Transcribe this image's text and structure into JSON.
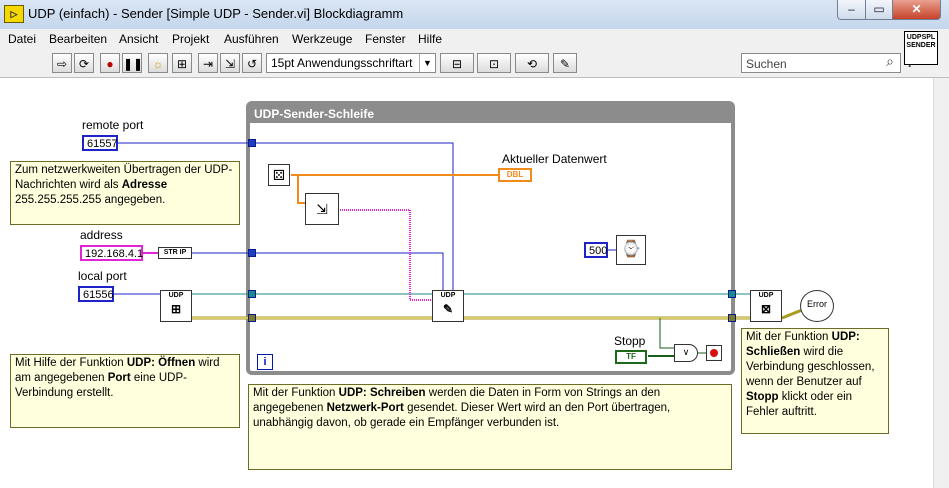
{
  "window": {
    "app_icon_label": "▷",
    "title": "UDP (einfach) - Sender [Simple UDP - Sender.vi] Blockdiagramm",
    "controls": {
      "minimize": "–",
      "maximize": "▭",
      "close": "✕"
    }
  },
  "menu": [
    "Datei",
    "Bearbeiten",
    "Ansicht",
    "Projekt",
    "Ausführen",
    "Werkzeuge",
    "Fenster",
    "Hilfe"
  ],
  "toolbar": {
    "buttons": [
      "⇨",
      "⟳",
      "●",
      "❚❚",
      "☼",
      "⊞",
      "⇥",
      "⇲",
      "↺"
    ],
    "font_value": "15pt Anwendungsschriftart",
    "align_icon": "⊟",
    "distribute_icon": "⊡",
    "reorder_icon": "⟲",
    "cleanup_icon": "✎",
    "search_placeholder": "Suchen",
    "help_glyph": "?",
    "vi_icon_lines": [
      "UDPSPL",
      "SENDER"
    ]
  },
  "diagram": {
    "loop_title": "UDP-Sender-Schleife",
    "loop_index": "i",
    "labels": {
      "remote_port": "remote port",
      "address": "address",
      "local_port": "local port",
      "current_value": "Aktueller Datenwert",
      "stop": "Stopp"
    },
    "constants": {
      "remote_port": "61557",
      "address": "192.168.4.1",
      "local_port": "61556",
      "wait_ms": "500",
      "str_ip": "STR IP",
      "dbl": "DBL",
      "tf": "TF"
    },
    "nodes": {
      "udp_open": "UDP",
      "udp_write": "UDP",
      "udp_close": "UDP",
      "error": "Error"
    },
    "comments": {
      "address": [
        {
          "text": "Zum netzwerkweiten Übertragen der UDP-"
        },
        {
          "text": "Nachrichten wird als "
        },
        {
          "bold": "Adresse"
        },
        {
          "text": "255.255.255.255 angegeben."
        }
      ],
      "open": [
        {
          "text": "Mit Hilfe der Funktion "
        },
        {
          "bold": "UDP: Öffnen"
        },
        {
          "text": " wird"
        },
        {
          "text": "am angegebenen "
        },
        {
          "bold": "Port"
        },
        {
          "text": " eine UDP-"
        },
        {
          "text": "Verbindung erstellt."
        }
      ],
      "write": [
        {
          "text": "Mit der Funktion "
        },
        {
          "bold": "UDP: Schreiben"
        },
        {
          "text": " werden die Daten in Form von Strings an den"
        },
        {
          "text": "angegebenen "
        },
        {
          "bold": "Netzwerk-Port"
        },
        {
          "text": " gesendet. Dieser Wert wird an den Port übertragen,"
        },
        {
          "text": "unabhängig davon, ob gerade ein Empfänger verbunden ist."
        }
      ],
      "close": [
        {
          "text": "Mit der Funktion "
        },
        {
          "bold": "UDP:"
        },
        {
          "bold": "Schließen"
        },
        {
          "text": " wird die"
        },
        {
          "text": "Verbindung geschlossen,"
        },
        {
          "text": "wenn der Benutzer auf"
        },
        {
          "bold": "Stopp"
        },
        {
          "text": " klickt oder ein"
        },
        {
          "text": "Fehler auftritt."
        }
      ]
    }
  },
  "colors": {
    "int_wire": "#1d22c9",
    "string_wire": "#e024d8",
    "refnum_wire": "#1b8a8c",
    "error_wire": "#a89a1a",
    "loop_border": "#8c8c8c",
    "comment_bg": "#ffffdd",
    "dbl_orange": "#f08a18"
  }
}
